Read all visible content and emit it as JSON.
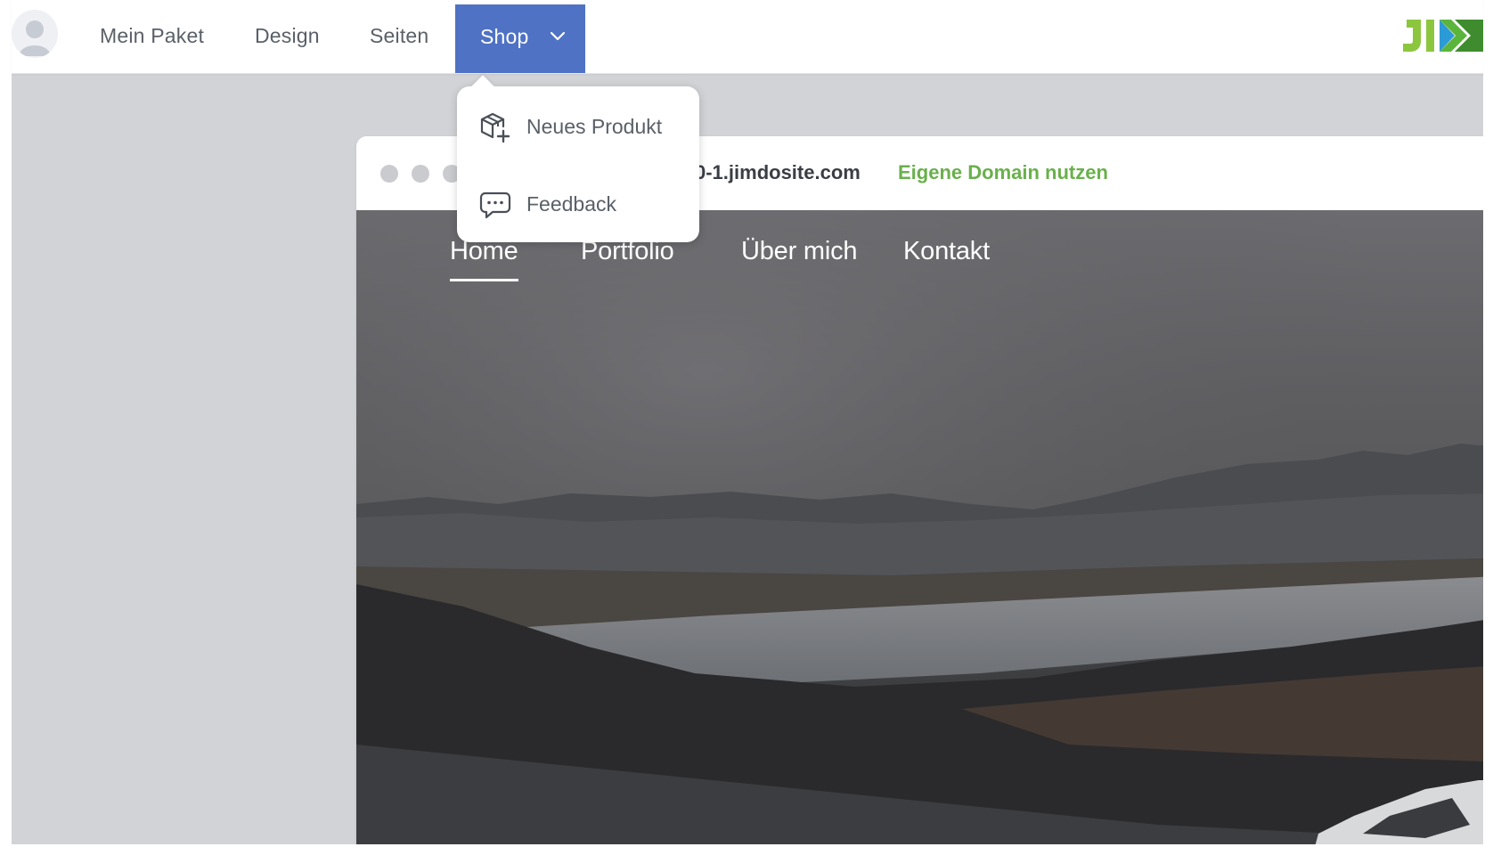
{
  "topbar": {
    "avatar_icon": "user-avatar-icon",
    "nav": {
      "mein_paket": "Mein Paket",
      "design": "Design",
      "seiten": "Seiten",
      "shop": "Shop"
    },
    "shop_caret_icon": "chevron-down-icon",
    "logo_text": "JIMDO",
    "active_color": "#4f72c4"
  },
  "dropdown": {
    "items": [
      {
        "label": "Neues Produkt",
        "icon": "box-plus-icon"
      },
      {
        "label": "Feedback",
        "icon": "chat-bubble-icon"
      }
    ]
  },
  "preview": {
    "url_text": "0-1.jimdosite.com",
    "domain_link": "Eigene Domain nutzen",
    "domain_link_color": "#6ab04c",
    "site_nav": [
      "Home",
      "Portfolio",
      "Über mich",
      "Kontakt"
    ],
    "active_page": "Home"
  }
}
